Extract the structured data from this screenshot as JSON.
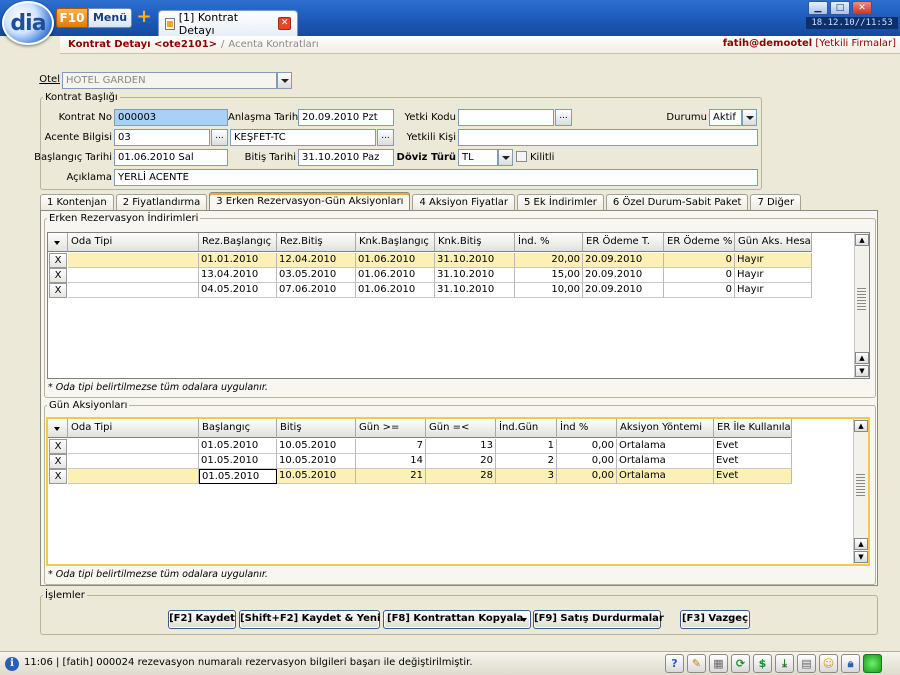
{
  "topbar": {
    "logo_text": "dia",
    "f10_label": "F10",
    "menu_label": "Menü",
    "tab_label": "[1] Kontrat Detayı",
    "clock": "18.12.10//11:53"
  },
  "breadcrumb": {
    "current": "Kontrat Detayı <ote2101>",
    "separator": "/",
    "previous": "Acenta Kontratları",
    "user": "fatih@demootel",
    "authorized_link": "[Yetkili Firmalar]"
  },
  "form": {
    "otel_label": "Otel",
    "otel_value": "HOTEL GARDEN",
    "header_group": "Kontrat Başlığı",
    "kontrat_no_label": "Kontrat No",
    "kontrat_no_value": "000003",
    "anlasma_label": "Anlaşma Tarihi",
    "anlasma_value": "20.09.2010 Pzt",
    "yetki_kodu_label": "Yetki Kodu",
    "yetki_kodu_value": "",
    "durumu_label": "Durumu",
    "durumu_value": "Aktif",
    "acente_label": "Acente Bilgisi",
    "acente_code": "03",
    "acente_name": "KEŞFET-TC",
    "yetkili_kisi_label": "Yetkili Kişi",
    "yetkili_kisi_value": "",
    "baslangic_label": "Başlangıç Tarihi",
    "baslangic_value": "01.06.2010 Sal",
    "bitis_label": "Bitiş Tarihi",
    "bitis_value": "31.10.2010 Paz",
    "doviz_label": "Döviz Türü",
    "doviz_value": "TL",
    "kilitli_label": "Kilitli",
    "aciklama_label": "Açıklama",
    "aciklama_value": "YERLİ ACENTE",
    "ellipsis": "..."
  },
  "tabs": [
    {
      "label": "1 Kontenjan"
    },
    {
      "label": "2 Fiyatlandırma"
    },
    {
      "label": "3 Erken Rezervasyon-Gün Aksiyonları"
    },
    {
      "label": "4 Aksiyon Fiyatlar"
    },
    {
      "label": "5 Ek İndirimler"
    },
    {
      "label": "6 Özel Durum-Sabit Paket"
    },
    {
      "label": "7 Diğer"
    }
  ],
  "erken": {
    "title": "Erken Rezervasyon İndirimleri",
    "headers": [
      "Oda Tipi",
      "Rez.Başlangıç",
      "Rez.Bitiş",
      "Knk.Başlangıç",
      "Knk.Bitiş",
      "İnd. %",
      "ER Ödeme T.",
      "ER Ödeme %",
      "Gün Aks. Hesap"
    ],
    "rows": [
      {
        "x": "X",
        "oda": "",
        "rez_bas": "01.01.2010",
        "rez_bit": "12.04.2010",
        "knk_bas": "01.06.2010",
        "knk_bit": "31.10.2010",
        "ind": "20,00",
        "er_t": "20.09.2010",
        "er_p": "0",
        "gun": "Hayır"
      },
      {
        "x": "X",
        "oda": "",
        "rez_bas": "13.04.2010",
        "rez_bit": "03.05.2010",
        "knk_bas": "01.06.2010",
        "knk_bit": "31.10.2010",
        "ind": "15,00",
        "er_t": "20.09.2010",
        "er_p": "0",
        "gun": "Hayır"
      },
      {
        "x": "X",
        "oda": "",
        "rez_bas": "04.05.2010",
        "rez_bit": "07.06.2010",
        "knk_bas": "01.06.2010",
        "knk_bit": "31.10.2010",
        "ind": "10,00",
        "er_t": "20.09.2010",
        "er_p": "0",
        "gun": "Hayır"
      }
    ],
    "note": "* Oda tipi belirtilmezse tüm odalara uygulanır."
  },
  "gun": {
    "title": "Gün Aksiyonları",
    "headers": [
      "Oda Tipi",
      "Başlangıç",
      "Bitiş",
      "Gün >=",
      "Gün =<",
      "İnd.Gün",
      "İnd %",
      "Aksiyon Yöntemi",
      "ER İle Kullanılab"
    ],
    "rows": [
      {
        "x": "X",
        "oda": "",
        "bas": "01.05.2010",
        "bit": "10.05.2010",
        "gmin": "7",
        "gmax": "13",
        "indgun": "1",
        "indp": "0,00",
        "yontem": "Ortalama",
        "er": "Evet"
      },
      {
        "x": "X",
        "oda": "",
        "bas": "01.05.2010",
        "bit": "10.05.2010",
        "gmin": "14",
        "gmax": "20",
        "indgun": "2",
        "indp": "0,00",
        "yontem": "Ortalama",
        "er": "Evet"
      },
      {
        "x": "X",
        "oda": "",
        "bas": "01.05.2010",
        "bit": "10.05.2010",
        "gmin": "21",
        "gmax": "28",
        "indgun": "3",
        "indp": "0,00",
        "yontem": "Ortalama",
        "er": "Evet"
      }
    ],
    "note": "* Oda tipi belirtilmezse tüm odalara uygulanır."
  },
  "actions": {
    "title": "İşlemler",
    "kaydet": "[F2] Kaydet",
    "kaydet_yeni": "[Shift+F2] Kaydet & Yeni",
    "kopyala": "[F8] Kontrattan Kopyala",
    "satis": "[F9] Satış Durdurmalar",
    "vazgec": "[F3] Vazgeç"
  },
  "status": {
    "text": "11:06 | [fatih] 000024 rezevasyon numaralı rezervasyon bilgileri başarı ile değiştirilmiştir."
  },
  "colors": {
    "accent": "#8b0000",
    "selected_row": "#fcf0b4",
    "active_input": "#a9d0f5"
  }
}
